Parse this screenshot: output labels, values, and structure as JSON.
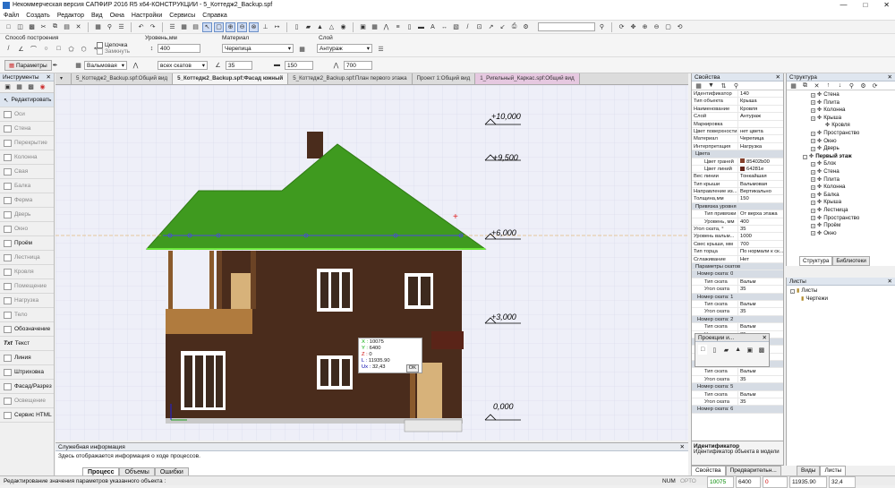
{
  "title": "Некоммерческая версия САПФИР 2016 R5 x64-КОНСТРУКЦИИ - 5_Коттедж2_Backup.spf",
  "menu": [
    "Файл",
    "Создать",
    "Редактор",
    "Вид",
    "Окна",
    "Настройки",
    "Сервисы",
    "Справка"
  ],
  "toolbar2": {
    "build_method_label": "Способ построения",
    "chain_label": "Цепочка",
    "close_label": "Замкнуть",
    "level_label": "Уровень,мм",
    "level_value": "400",
    "material_label": "Материал",
    "material_value": "Черепица",
    "layer_label": "Слой",
    "layer_value": "Антураж"
  },
  "toolbar3": {
    "params_button": "Параметры",
    "roof_type": "Вальмовая",
    "slopes": "всех скатов",
    "angle": "35",
    "thickness": "150",
    "overhang": "700"
  },
  "left_panel": {
    "title": "Инструменты",
    "tools": [
      "Редактировать",
      "Оси",
      "Стена",
      "Перекрытие",
      "Колонна",
      "Свая",
      "Балка",
      "Ферма",
      "Дверь",
      "Окно",
      "Проём",
      "Лестница",
      "Кровля",
      "Помещение",
      "Нагрузка",
      "Тело",
      "Обозначение",
      "Текст",
      "Линия",
      "Штриховка",
      "Фасад/Разрез",
      "Освещение",
      "Сервис HTML"
    ]
  },
  "doc_tabs": [
    "5_Коттедж2_Backup.spf:Общий вид",
    "5_Коттедж2_Backup.spf:Фасад южный",
    "5_Коттедж2_Backup.spf:План первого этажа",
    "Проект 1:Общий вид",
    "1_Ригельный_Каркас.spf:Общий вид"
  ],
  "levels": [
    "+10,000",
    "+9,500",
    "+6,000",
    "+3,000",
    "0,000"
  ],
  "coord_box": {
    "x": "10075",
    "y": "6400",
    "z": "0",
    "l": "11935.90",
    "ux": "32,43",
    "ok": "OK"
  },
  "projections": {
    "title": "Проекции и..."
  },
  "info_panel": {
    "title": "Служебная информация",
    "text": "Здесь отображается информация о ходе процессов.",
    "tabs": [
      "Процесс",
      "Объемы",
      "Ошибки"
    ]
  },
  "properties": {
    "title": "Свойства",
    "rows": [
      {
        "k": "Идентификатор",
        "v": "140",
        "t": "row"
      },
      {
        "k": "Тип объекта",
        "v": "Крыша",
        "t": "row"
      },
      {
        "k": "Наименование",
        "v": "Кровля",
        "t": "row"
      },
      {
        "k": "Слой",
        "v": "Антураж",
        "t": "row"
      },
      {
        "k": "Маркировка",
        "v": "",
        "t": "row"
      },
      {
        "k": "Цвет поверхности",
        "v": "нет цвета",
        "t": "row"
      },
      {
        "k": "Материал",
        "v": "Черепица",
        "t": "row"
      },
      {
        "k": "Интерпретация",
        "v": "Нагрузка",
        "t": "row"
      },
      {
        "k": "Цвета",
        "v": "",
        "t": "grp"
      },
      {
        "k": "Цвет граней",
        "v": "85402b00",
        "t": "ind",
        "c": "#85402b"
      },
      {
        "k": "Цвет линий",
        "v": "64281e",
        "t": "ind",
        "c": "#64281e"
      },
      {
        "k": "Вес линии",
        "v": "Тонкайшая",
        "t": "row"
      },
      {
        "k": "Тип крыши",
        "v": "Вальмовая",
        "t": "row"
      },
      {
        "k": "Направление из...",
        "v": "Вертикально",
        "t": "row"
      },
      {
        "k": "Толщина,мм",
        "v": "150",
        "t": "row"
      },
      {
        "k": "Привязка уровня",
        "v": "",
        "t": "grp"
      },
      {
        "k": "Тип привязки",
        "v": "От верха этажа",
        "t": "ind"
      },
      {
        "k": "Уровень, мм",
        "v": "400",
        "t": "ind"
      },
      {
        "k": "Угол ската, °",
        "v": "35",
        "t": "row"
      },
      {
        "k": "Уровень вальм...",
        "v": "1000",
        "t": "row"
      },
      {
        "k": "Свес крыши, мм",
        "v": "700",
        "t": "row"
      },
      {
        "k": "Тип торца",
        "v": "По нормали к ск...",
        "t": "row"
      },
      {
        "k": "Сглаживание",
        "v": "Нет",
        "t": "row"
      },
      {
        "k": "Параметры скатов",
        "v": "",
        "t": "grp"
      },
      {
        "k": "Номер ската: 0",
        "v": "",
        "t": "grp2"
      },
      {
        "k": "Тип ската",
        "v": "Вальм",
        "t": "ind"
      },
      {
        "k": "Угол ската",
        "v": "35",
        "t": "ind"
      },
      {
        "k": "Номер ската: 1",
        "v": "",
        "t": "grp2"
      },
      {
        "k": "Тип ската",
        "v": "Вальм",
        "t": "ind"
      },
      {
        "k": "Угол ската",
        "v": "35",
        "t": "ind"
      },
      {
        "k": "Номер ската: 2",
        "v": "",
        "t": "grp2"
      },
      {
        "k": "Тип ската",
        "v": "Вальм",
        "t": "ind"
      },
      {
        "k": "Угол ската",
        "v": "35",
        "t": "ind"
      },
      {
        "k": "Номер ската: 3",
        "v": "",
        "t": "grp2"
      },
      {
        "k": "Тип ската",
        "v": "Вальм",
        "t": "ind"
      },
      {
        "k": "Угол ската",
        "v": "35",
        "t": "ind"
      },
      {
        "k": "Номер ската: 4",
        "v": "",
        "t": "grp2"
      },
      {
        "k": "Тип ската",
        "v": "Вальм",
        "t": "ind"
      },
      {
        "k": "Угол ската",
        "v": "35",
        "t": "ind"
      },
      {
        "k": "Номер ската: 5",
        "v": "",
        "t": "grp2"
      },
      {
        "k": "Тип ската",
        "v": "Вальм",
        "t": "ind"
      },
      {
        "k": "Угол ската",
        "v": "35",
        "t": "ind"
      },
      {
        "k": "Номер ската: 6",
        "v": "",
        "t": "grp2"
      }
    ],
    "desc_title": "Идентификатор",
    "desc_text": "Идентификатор объекта в модели",
    "tabs": [
      "Свойства",
      "Предварительн..."
    ]
  },
  "structure": {
    "title": "Структура",
    "items": [
      {
        "t": "Стена",
        "l": 3
      },
      {
        "t": "Плита",
        "l": 3
      },
      {
        "t": "Колонна",
        "l": 3
      },
      {
        "t": "Крыша",
        "l": 3
      },
      {
        "t": "Кровля",
        "l": 4
      },
      {
        "t": "Пространство",
        "l": 3
      },
      {
        "t": "Окно",
        "l": 3
      },
      {
        "t": "Дверь",
        "l": 3
      },
      {
        "t": "Первый этаж",
        "l": 2,
        "b": true
      },
      {
        "t": "Блок",
        "l": 3
      },
      {
        "t": "Стена",
        "l": 3
      },
      {
        "t": "Плита",
        "l": 3
      },
      {
        "t": "Колонна",
        "l": 3
      },
      {
        "t": "Балка",
        "l": 3
      },
      {
        "t": "Крыша",
        "l": 3
      },
      {
        "t": "Лестница",
        "l": 3
      },
      {
        "t": "Пространство",
        "l": 3
      },
      {
        "t": "Проём",
        "l": 3
      },
      {
        "t": "Окно",
        "l": 3
      }
    ],
    "tabs": [
      "Структура",
      "Библиотеки"
    ]
  },
  "lists_panel": {
    "title": "Листы",
    "items": [
      "Листы",
      "Чертежи"
    ],
    "tabs": [
      "Виды",
      "Листы"
    ]
  },
  "status": {
    "hint": "Редактирование значения параметров указанного объекта :",
    "num": "NUM",
    "opts": "ОРТО",
    "x": "10075",
    "y": "6400",
    "z": "0",
    "l": "11935.90",
    "ux": "32,4"
  },
  "colors": {
    "roof": "#3f9a1f",
    "wall": "#4a2c1c",
    "balcony": "#b07b3e",
    "door": "#d7b27a"
  }
}
